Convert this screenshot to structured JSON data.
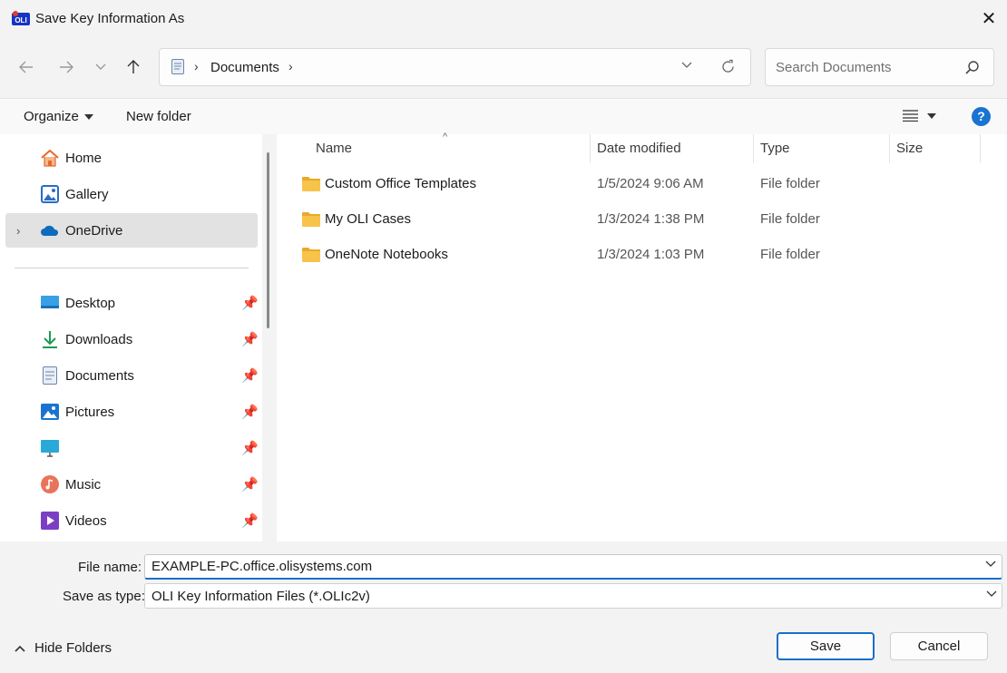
{
  "window": {
    "title": "Save Key Information As",
    "close_icon": "close-icon"
  },
  "address_bar": {
    "crumbs": [
      "Documents"
    ],
    "search_placeholder": "Search Documents"
  },
  "toolbar": {
    "organize_label": "Organize",
    "new_folder_label": "New folder"
  },
  "sidebar": {
    "top_items": [
      {
        "label": "Home",
        "icon": "home-icon"
      },
      {
        "label": "Gallery",
        "icon": "gallery-icon"
      },
      {
        "label": "OneDrive",
        "icon": "onedrive-icon"
      }
    ],
    "pinned_items": [
      {
        "label": "Desktop",
        "icon": "desktop-icon"
      },
      {
        "label": "Downloads",
        "icon": "downloads-icon"
      },
      {
        "label": "Documents",
        "icon": "documents-icon"
      },
      {
        "label": "Pictures",
        "icon": "pictures-icon"
      },
      {
        "label": "",
        "icon": "monitor-icon"
      },
      {
        "label": "Music",
        "icon": "music-icon"
      },
      {
        "label": "Videos",
        "icon": "videos-icon"
      }
    ]
  },
  "columns": {
    "name": "Name",
    "date": "Date modified",
    "type": "Type",
    "size": "Size"
  },
  "files": [
    {
      "name": "Custom Office Templates",
      "date": "1/5/2024 9:06 AM",
      "type": "File folder"
    },
    {
      "name": "My OLI Cases",
      "date": "1/3/2024 1:38 PM",
      "type": "File folder"
    },
    {
      "name": "OneNote Notebooks",
      "date": "1/3/2024 1:03 PM",
      "type": "File folder"
    }
  ],
  "form": {
    "file_name_label": "File name:",
    "file_name_value": "EXAMPLE-PC.office.olisystems.com",
    "save_type_label": "Save as type:",
    "save_type_value": "OLI Key Information Files (*.OLIc2v)"
  },
  "footer": {
    "hide_folders_label": "Hide Folders",
    "save_label": "Save",
    "cancel_label": "Cancel"
  },
  "colors": {
    "accent": "#1a6fc9",
    "folder": "#f7c34b",
    "selected_bg": "#e2e2e2"
  }
}
